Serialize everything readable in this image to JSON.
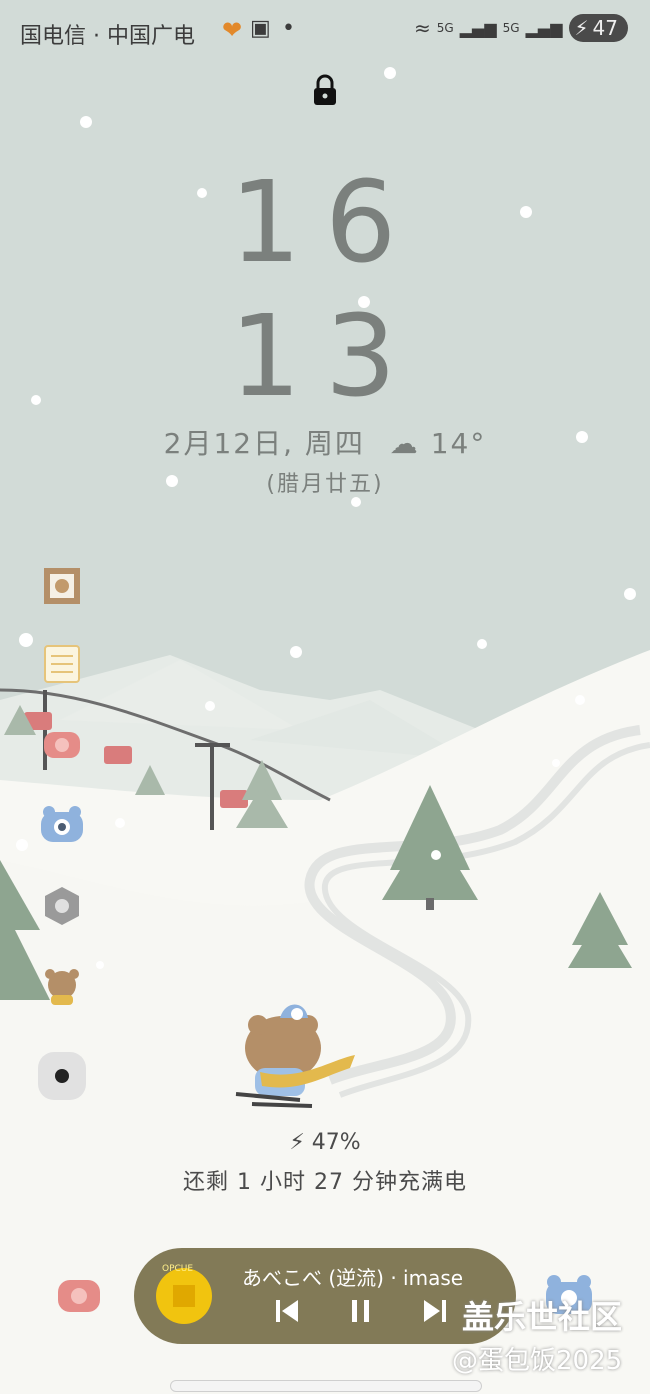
{
  "status_bar": {
    "carrier_text": "国电信 · 中国广电",
    "battery_level": "47",
    "network_labels": [
      "5G",
      "5G"
    ]
  },
  "lockscreen": {
    "hour": "16",
    "minute": "13",
    "date": "2月12日, 周四",
    "temperature": "14°",
    "weather_icon": "fog-icon",
    "lunar_date": "(腊月廿五)"
  },
  "side_widgets": [
    "picture-frame-icon",
    "notepad-icon",
    "phone-icon",
    "camera-icon",
    "settings-icon",
    "bear-icon",
    "record-icon"
  ],
  "charging": {
    "percent_text": "47%",
    "remaining_text": "还剩 1 小时 27 分钟充满电"
  },
  "music_player": {
    "title": "あべこべ (逆流) · imase",
    "album_text": "OPCUE"
  },
  "watermark": {
    "line1": "盖乐世社区",
    "line2": "@蛋包饭2025"
  },
  "colors": {
    "sky": "#d2dbd7",
    "snow": "#f8f8f4",
    "tree": "#8ea590",
    "clock_text": "#7b807d",
    "music_bg": "#827a57"
  }
}
